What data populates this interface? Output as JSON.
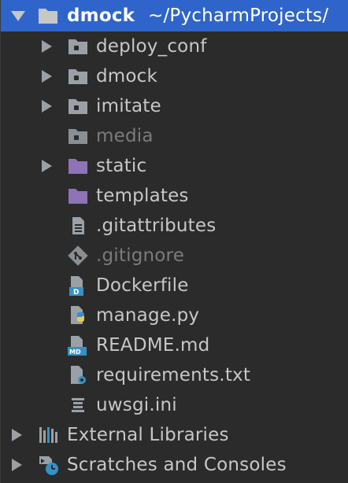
{
  "root": {
    "name": "dmock",
    "path": "~/PycharmProjects/"
  },
  "items": [
    {
      "label": "deploy_conf",
      "type": "folder",
      "expandable": true,
      "dim": false
    },
    {
      "label": "dmock",
      "type": "folder",
      "expandable": true,
      "dim": false
    },
    {
      "label": "imitate",
      "type": "folder",
      "expandable": true,
      "dim": false
    },
    {
      "label": "media",
      "type": "folder",
      "expandable": false,
      "dim": true
    },
    {
      "label": "static",
      "type": "resource-folder",
      "expandable": true,
      "dim": false
    },
    {
      "label": "templates",
      "type": "resource-folder",
      "expandable": false,
      "dim": false
    },
    {
      "label": ".gitattributes",
      "type": "text-file",
      "expandable": false,
      "dim": false
    },
    {
      "label": ".gitignore",
      "type": "git-file",
      "expandable": false,
      "dim": true
    },
    {
      "label": "Dockerfile",
      "type": "docker-file",
      "expandable": false,
      "dim": false
    },
    {
      "label": "manage.py",
      "type": "python-file",
      "expandable": false,
      "dim": false
    },
    {
      "label": "README.md",
      "type": "markdown-file",
      "expandable": false,
      "dim": false
    },
    {
      "label": "requirements.txt",
      "type": "requirements-file",
      "expandable": false,
      "dim": false
    },
    {
      "label": "uwsgi.ini",
      "type": "ini-file",
      "expandable": false,
      "dim": false
    }
  ],
  "external_libraries": {
    "label": "External Libraries"
  },
  "scratches": {
    "label": "Scratches and Consoles"
  },
  "colors": {
    "background": "#2b2b2b",
    "selection": "#2f65ca",
    "folder": "#9aa0a6",
    "resource_folder": "#8e73b7",
    "accent_blue": "#3592c4",
    "text": "#c7c7c7",
    "dim_text": "#7b7b7b"
  }
}
